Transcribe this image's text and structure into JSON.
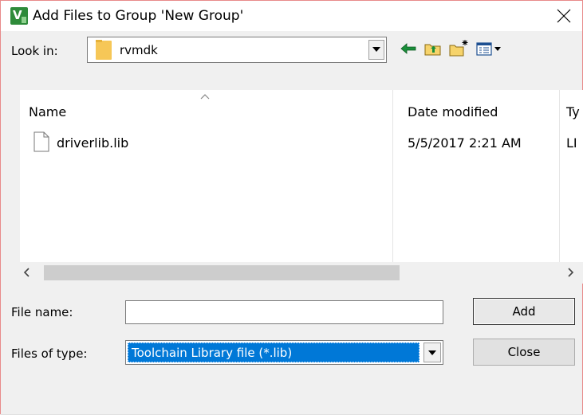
{
  "window": {
    "title": "Add Files to Group 'New Group'",
    "app_icon": "keil-uvision-icon"
  },
  "toolbar": {
    "look_in_label": "Look in:",
    "look_in_value": "rvmdk",
    "tools": [
      "back-arrow-icon",
      "up-folder-icon",
      "new-folder-icon",
      "view-menu-icon"
    ]
  },
  "filelist": {
    "columns": [
      "Name",
      "Date modified",
      "Ty"
    ],
    "rows": [
      {
        "name": "driverlib.lib",
        "date": "5/5/2017 2:21 AM",
        "type": "LI"
      }
    ]
  },
  "form": {
    "file_name_label": "File name:",
    "file_name_value": "",
    "files_of_type_label": "Files of type:",
    "files_of_type_value": "Toolchain Library file (*.lib)"
  },
  "buttons": {
    "add_label": "Add",
    "close_label": "Close"
  },
  "colors": {
    "selection": "#0078d7",
    "folder": "#f6c757",
    "arrow_green": "#1a8f3a"
  }
}
